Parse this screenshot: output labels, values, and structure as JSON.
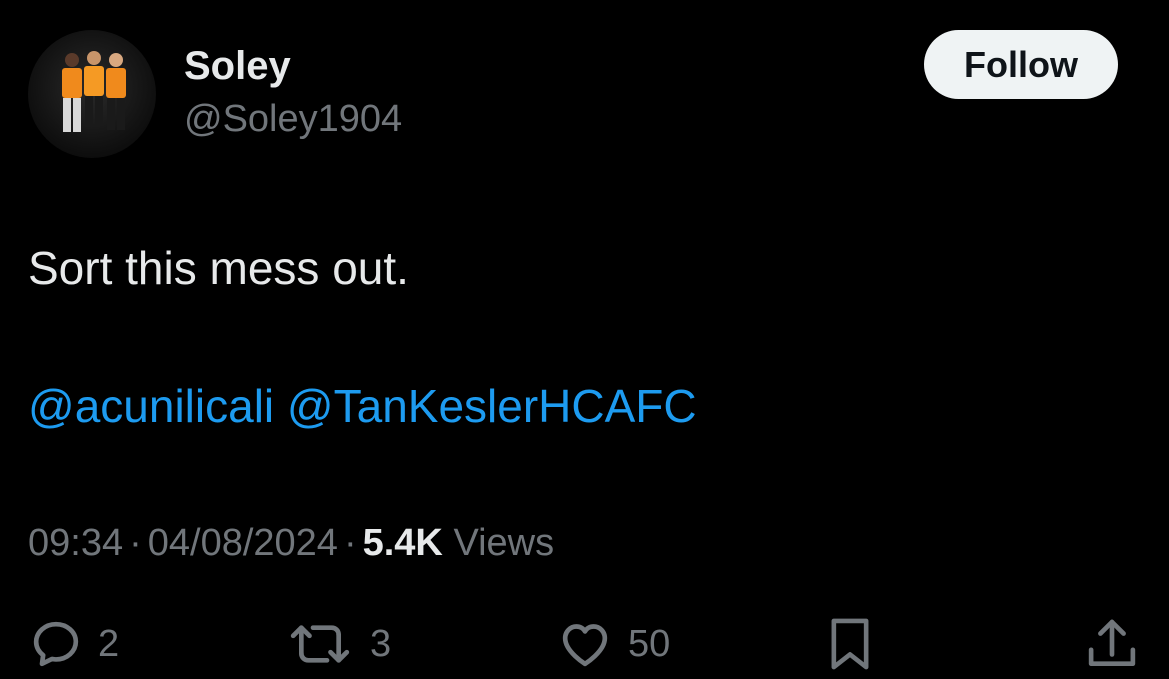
{
  "author": {
    "display_name": "Soley",
    "handle": "@Soley1904",
    "avatar_icon": "avatar-photo-three-players-orange-kits"
  },
  "follow_button": {
    "label": "Follow"
  },
  "tweet": {
    "text": "Sort this mess out.",
    "mentions": [
      "@acunilicali",
      "@TanKeslerHCAFC"
    ]
  },
  "meta": {
    "time": "09:34",
    "separator": "·",
    "date": "04/08/2024",
    "views_count": "5.4K",
    "views_label": "Views"
  },
  "actions": {
    "reply": {
      "icon": "reply-icon",
      "count": "2"
    },
    "repost": {
      "icon": "repost-icon",
      "count": "3"
    },
    "like": {
      "icon": "heart-icon",
      "count": "50"
    },
    "bookmark": {
      "icon": "bookmark-icon"
    },
    "share": {
      "icon": "share-icon"
    }
  },
  "colors": {
    "background": "#000000",
    "primary_text": "#e7e9ea",
    "secondary_text": "#71767b",
    "link": "#1d9bf0",
    "follow_button_bg": "#eff3f4"
  }
}
